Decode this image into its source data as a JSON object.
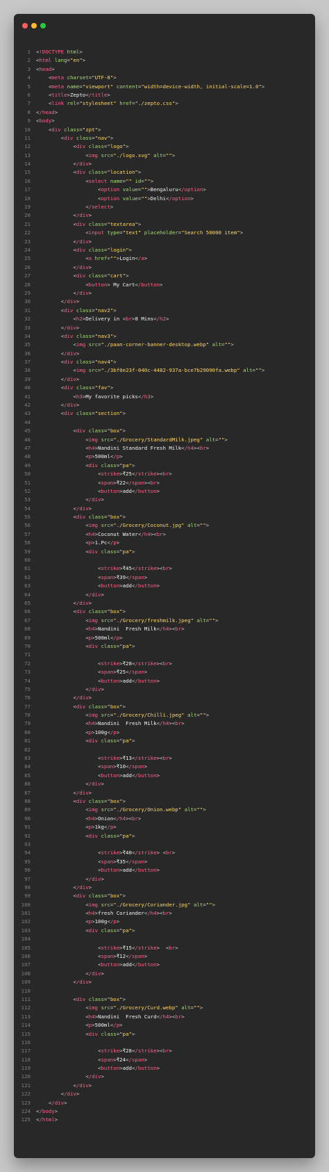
{
  "window": {
    "buttons": [
      "close-icon",
      "minimize-icon",
      "maximize-icon"
    ],
    "colors": {
      "background": "#282828",
      "tag": "#ff6188",
      "attr": "#a9dc76",
      "string": "#ffd866",
      "text": "#f2f2f2",
      "line_number": "#7f7f7f"
    }
  },
  "lines": [
    "<!DOCTYPE html>",
    "<html lang=\"en\">",
    "<head>",
    "    <meta charset=\"UTF-8\">",
    "    <meta name=\"viewport\" content=\"width=device-width, initial-scale=1.0\">",
    "    <title>Zepto</title>",
    "    <link rel=\"stylesheet\" href=\"./zepto.css\">",
    "</head>",
    "<body>",
    "    <div class=\"zpt\">",
    "        <div class=\"nav\">",
    "            <div class=\"logo\">",
    "                <img src=\"./logo.svg\" alt=\"\">",
    "            </div>",
    "            <div class=\"location\">",
    "                <select name=\"\" id=\"\">",
    "                    <option value=\"\">Bengaluru</option>",
    "                    <option value=\"\">Delhi</option>",
    "                </select>",
    "            </div>",
    "            <div class=\"textarea\">",
    "                <input type=\"text\" placeholder=\"Search 50000 item\">",
    "            </div>",
    "            <div class=\"login\">",
    "                <a href=\"\">Login</a>",
    "            </div>",
    "            <div class=\"cart\">",
    "                <button> My Cart</button>",
    "            </div>",
    "        </div>",
    "        <div class=\"nav2\">",
    "            <h2>Delivery in <br>8 Mins</h2>",
    "        </div>",
    "        <div class=\"nav3\">",
    "            <img src=\"./paan-corner-banner-desktop.webp\" alt=\"\">",
    "        </div>",
    "        <div class=\"nav4\">",
    "            <img src=\"./3bf0e23f-040c-4482-937a-bce7b29090fa.webp\" alt=\"\">",
    "        </div>",
    "        <div class=\"fav\">",
    "            <h3>My favorite picks</h3>",
    "        </div>",
    "        <div class=\"section\">",
    "",
    "            <div class=\"box\">",
    "                <img src=\"./Grocery/StandardMilk.jpeg\" alt=\"\">",
    "                <h4>Nandini Standard Fresh Milk</h4><br>",
    "                <p>500ml</p>",
    "                <div class=\"pa\">",
    "                    <strike>₹25</strike><br>",
    "                    <span>₹22</span><br>",
    "                    <button>add</button>",
    "                </div>",
    "            </div>",
    "            <div class=\"box\">",
    "                <img src=\"./Grocery/Coconut.jpg\" alt=\"\">",
    "                <h4>Coconut Water</h4><br>",
    "                <p>1.Pc</p>",
    "                <div class=\"pa\">",
    "",
    "                    <strike>₹45</strike><br>",
    "                    <span>₹39</span>",
    "                    <button>add</button>",
    "                </div>",
    "            </div>",
    "            <div class=\"box\">",
    "                <img src=\"./Grocery/freshmilk.jpeg\" alt=\"\">",
    "                <h4>Nandini  Fresh Milk</h4><br>",
    "                <p>500ml</p>",
    "                <div class=\"pa\">",
    "",
    "                    <strike>₹28</strike><br>",
    "                    <span>₹25</span>",
    "                    <button>add</button>",
    "                </div>",
    "            </div>",
    "            <div class=\"box\">",
    "                <img src=\"./Grocery/Chilli.jpeg\" alt=\"\">",
    "                <h4>Nandini  Fresh Milk</h4><br>",
    "                <p>100g</p>",
    "                <div class=\"pa\">",
    "",
    "                    <strike>₹13</strike><br>",
    "                    <span>₹10</span>",
    "                    <button>add</button>",
    "                </div>",
    "            </div>",
    "            <div class=\"box\">",
    "                <img src=\"./Grocery/Onion.webp\" alt=\"\">",
    "                <h4>Onion</h4><br>",
    "                <p>1kg</p>",
    "                <div class=\"pa\">",
    "",
    "                    <strike>₹40</strike> <br>",
    "                    <span>₹35</span>",
    "                    <button>add</button>",
    "                </div>",
    "            </div>",
    "            <div class=\"box\">",
    "                <img src=\"./Grocery/Coriander.jpg\" alt=\"\">",
    "                <h4>fresh Coriander</h4><br>",
    "                <p>100g</p>",
    "                <div class=\"pa\">",
    "",
    "                    <strike>₹15</strike>  <br>",
    "                    <span>₹12</span>",
    "                    <button>add</button>",
    "                </div>",
    "            </div>",
    "",
    "            <div class=\"box\">",
    "                <img src=\"./Grocery/Curd.webp\" alt=\"\">",
    "                <h4>Nandini  Fresh Curd</h4><br>",
    "                <p>500ml</p>",
    "                <div class=\"pa\">",
    "",
    "                    <strike>₹28</strike><br>",
    "                    <span>₹24</span>",
    "                    <button>add</button>",
    "                </div>",
    "            </div>",
    "        </div>",
    "    </div>",
    "</body>",
    "</html>"
  ]
}
